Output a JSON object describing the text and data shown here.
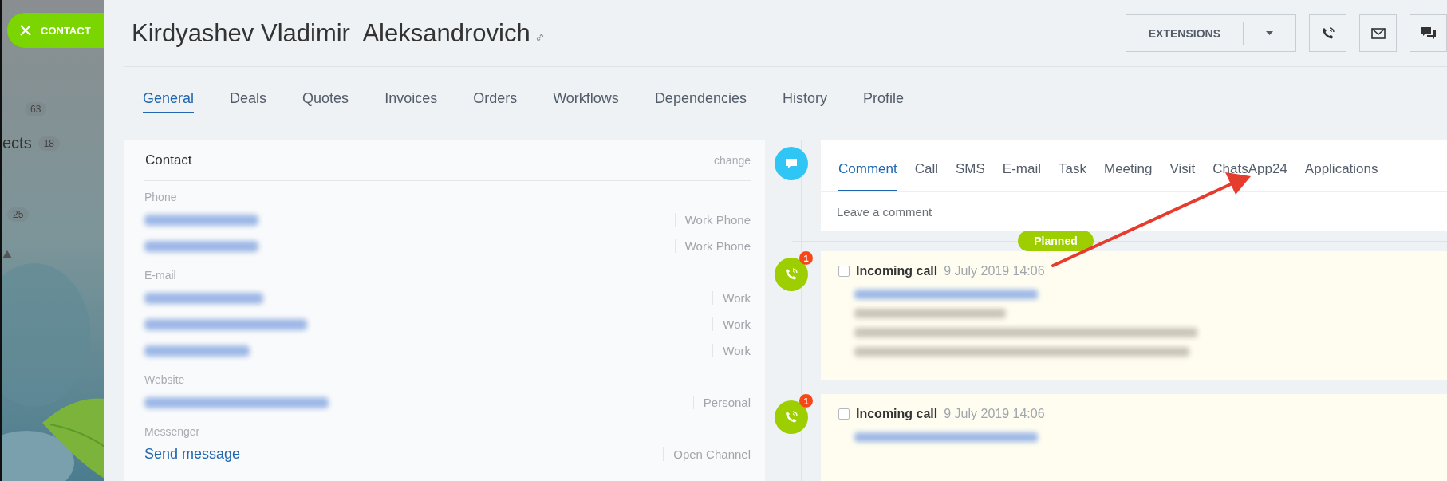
{
  "sidebar": {
    "badge": {
      "label": "CONTACT"
    },
    "items": [
      {
        "count": "63"
      },
      {
        "label": "ects",
        "count": "18"
      },
      {
        "count": "25"
      }
    ]
  },
  "title": "Kirdyashev Vladimir  Aleksandrovich",
  "toolbar": {
    "extensions": "EXTENSIONS"
  },
  "tabs": [
    {
      "label": "General",
      "selected": true
    },
    {
      "label": "Deals",
      "selected": false
    },
    {
      "label": "Quotes",
      "selected": false
    },
    {
      "label": "Invoices",
      "selected": false
    },
    {
      "label": "Orders",
      "selected": false
    },
    {
      "label": "Workflows",
      "selected": false
    },
    {
      "label": "Dependencies",
      "selected": false
    },
    {
      "label": "History",
      "selected": false
    },
    {
      "label": "Profile",
      "selected": false
    }
  ],
  "contact_card": {
    "title": "Contact",
    "action": "change",
    "sections": [
      {
        "label": "Phone",
        "rows": [
          {
            "kind": "blurred",
            "type": "Work Phone"
          },
          {
            "kind": "blurred",
            "type": "Work Phone"
          }
        ]
      },
      {
        "label": "E-mail",
        "rows": [
          {
            "kind": "blurred",
            "type": "Work"
          },
          {
            "kind": "blurred",
            "type": "Work"
          },
          {
            "kind": "blurred",
            "type": "Work"
          }
        ]
      },
      {
        "label": "Website",
        "rows": [
          {
            "kind": "blurred",
            "type": "Personal"
          }
        ]
      },
      {
        "label": "Messenger",
        "rows": [
          {
            "kind": "link",
            "value": "Send message",
            "type": "Open Channel"
          }
        ]
      }
    ]
  },
  "timeline": {
    "editor": {
      "tabs": [
        {
          "label": "Comment",
          "selected": true
        },
        {
          "label": "Call",
          "selected": false
        },
        {
          "label": "SMS",
          "selected": false
        },
        {
          "label": "E-mail",
          "selected": false
        },
        {
          "label": "Task",
          "selected": false
        },
        {
          "label": "Meeting",
          "selected": false
        },
        {
          "label": "Visit",
          "selected": false
        },
        {
          "label": "ChatsApp24",
          "selected": false
        },
        {
          "label": "Applications",
          "selected": false
        }
      ],
      "placeholder": "Leave a comment"
    },
    "divider_label": "Planned",
    "items": [
      {
        "title": "Incoming call",
        "date": "9 July 2019 14:06",
        "badge": "1",
        "checked": false
      },
      {
        "title": "Incoming call",
        "date": "9 July 2019 14:06",
        "badge": "1",
        "checked": false
      }
    ]
  }
}
